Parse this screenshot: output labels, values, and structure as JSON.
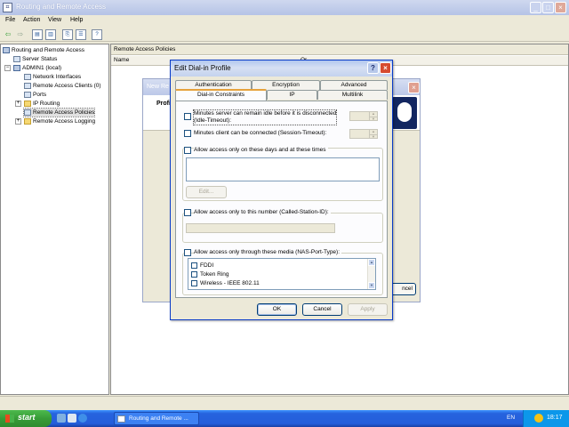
{
  "window": {
    "title": "Routing and Remote Access",
    "minimize_glyph": "_",
    "maximize_glyph": "□",
    "close_glyph": "×"
  },
  "menu": {
    "file": "File",
    "action": "Action",
    "view": "View",
    "help": "Help"
  },
  "toolbar": {
    "back_icon": "back-arrow-icon",
    "forward_icon": "forward-arrow-icon",
    "back_glyph": "⇦",
    "forward_glyph": "⇨",
    "properties_glyph": "▤",
    "console_glyph": "▥",
    "export_glyph": "⎘",
    "list_glyph": "☰",
    "help_glyph": "?"
  },
  "tree": {
    "root": "Routing and Remote Access",
    "items": [
      "Server Status",
      "ADMIN1 (local)",
      "Network Interfaces",
      "Remote Access Clients (0)",
      "Ports",
      "IP Routing",
      "Remote Access Policies",
      "Remote Access Logging"
    ],
    "expand_glyph": "+",
    "collapse_glyph": "−"
  },
  "right_pane": {
    "header": "Remote Access Policies",
    "column_name": "Name",
    "column_order": "Or"
  },
  "bg_dialog": {
    "title": "New Re",
    "header": "Profi",
    "cancel": "ncel",
    "close_glyph": "×"
  },
  "dialog": {
    "title": "Edit Dial-in Profile",
    "help_glyph": "?",
    "close_glyph": "×",
    "tabs_row1": [
      "Authentication",
      "Encryption",
      "Advanced"
    ],
    "tabs_row2": [
      "Dial-in Constraints",
      "IP",
      "Multilink"
    ],
    "active_tab": "Dial-in Constraints",
    "idle_label_line1": "Minutes server can remain idle before it is disconnected",
    "idle_label_line2": "(Idle-Timeout):",
    "session_label": "Minutes client can be connected (Session-Timeout):",
    "days_label": "Allow access only on these days and at these times",
    "edit_button": "Edit...",
    "number_label": "Allow access only to this number (Called-Station-ID):",
    "media_label": "Allow access only through these media (NAS-Port-Type):",
    "media_items": [
      "FDDI",
      "Token Ring",
      "Wireless - IEEE 802.11"
    ],
    "spin_up": "▲",
    "spin_down": "▼",
    "buttons": {
      "ok": "OK",
      "cancel": "Cancel",
      "apply": "Apply"
    }
  },
  "taskbar": {
    "start": "start",
    "task": "Routing and Remote ...",
    "lang": "EN",
    "time": "18:17"
  },
  "colors": {
    "dialog_border": "#0a3cc8",
    "close_red": "#d64b2e",
    "start_green": "#379c37",
    "taskbar_blue": "#245edb",
    "tab_highlight": "#e6a23c"
  }
}
